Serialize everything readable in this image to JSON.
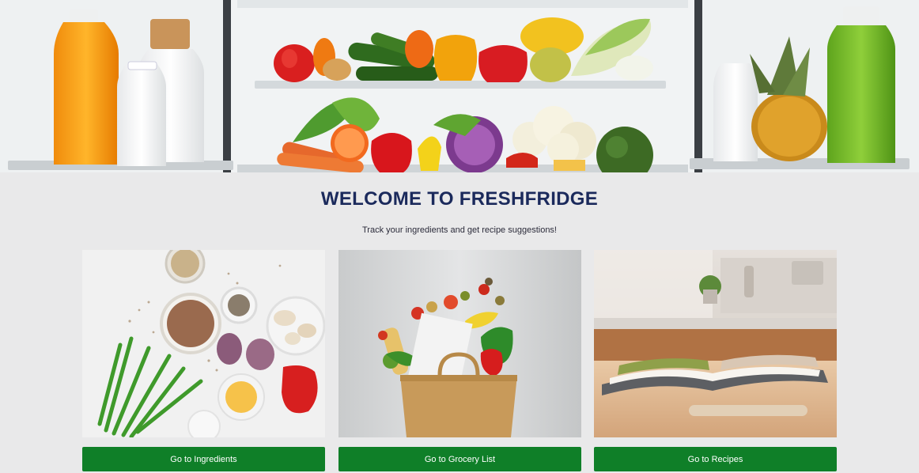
{
  "header": {
    "title": "WELCOME TO FRESHFRIDGE",
    "subtitle": "Track your ingredients and get recipe suggestions!"
  },
  "cards": [
    {
      "image": "ingredients-photo",
      "button_label": "Go to Ingredients"
    },
    {
      "image": "grocery-bag-photo",
      "button_label": "Go to Grocery List"
    },
    {
      "image": "recipe-book-photo",
      "button_label": "Go to Recipes"
    }
  ],
  "colors": {
    "title": "#1b2a5c",
    "button_bg": "#0f7f28",
    "button_text": "#ffffff",
    "page_bg": "#e9e9ea"
  }
}
